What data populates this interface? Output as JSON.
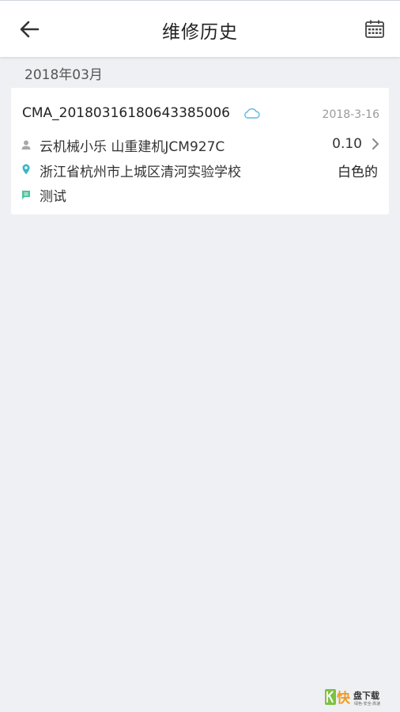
{
  "header": {
    "title": "维修历史",
    "back_icon": "arrow-left-icon",
    "calendar_icon": "calendar-icon"
  },
  "section": {
    "month": "2018年03月"
  },
  "record": {
    "order_id": "CMA_20180316180643385006",
    "sync_icon": "cloud-icon",
    "date": "2018-3-16",
    "customer": "云机械小乐  山重建机JCM927C",
    "price": "0.10",
    "address": "浙江省杭州市上城区清河实验学校",
    "color": "白色的",
    "note": "测试"
  },
  "watermark": {
    "brand": "快",
    "name": "盘下载",
    "tagline": "绿色·安全·高速"
  },
  "colors": {
    "accent_blue": "#5bb7e8",
    "pin_teal": "#3ab6c8",
    "note_green": "#4cc59e",
    "watermark_orange": "#f29a1f",
    "watermark_green": "#7cc242"
  }
}
